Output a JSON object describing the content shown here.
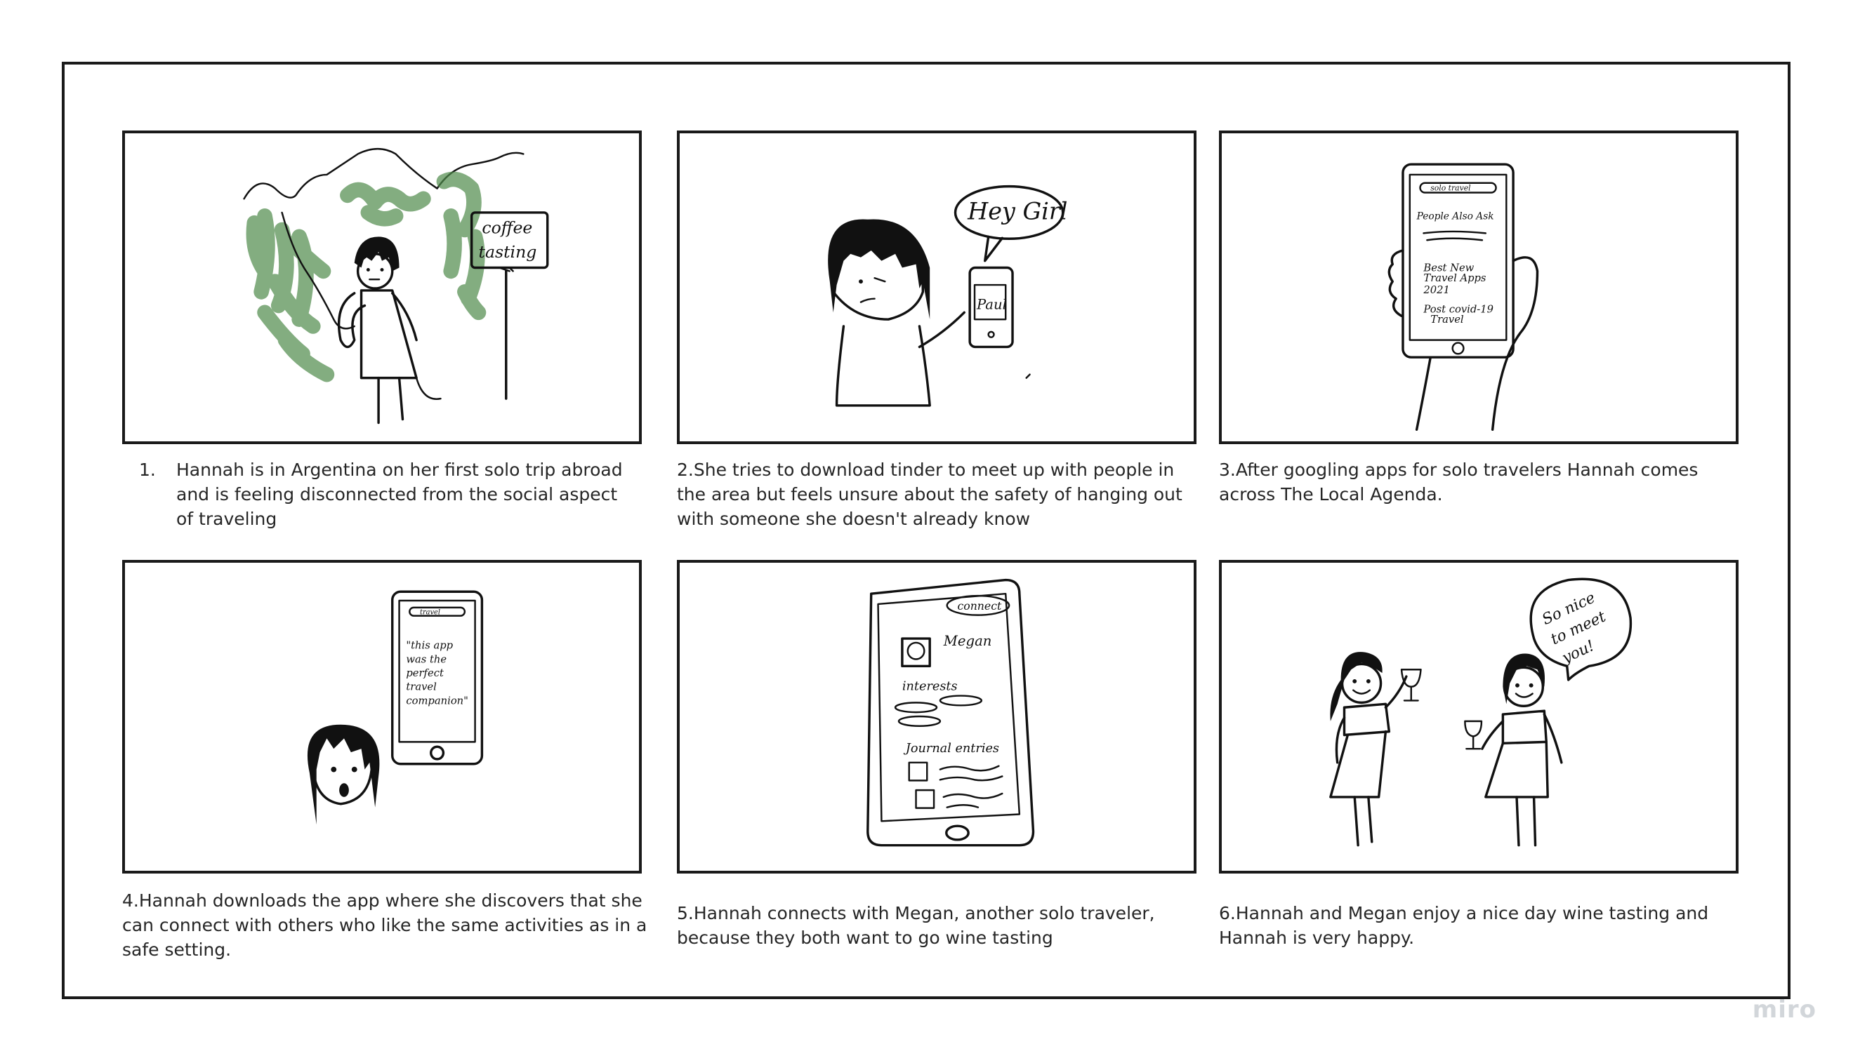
{
  "panels": [
    {
      "id": 1,
      "number": "1.",
      "caption": "Hannah is in Argentina on her first solo trip abroad and is feeling disconnected from the social aspect of traveling",
      "sketch_text": [
        "coffee",
        "tasting"
      ]
    },
    {
      "id": 2,
      "caption": "2.She tries to download tinder to meet up with people in the area but feels unsure about the safety of hanging out with someone she doesn't already know",
      "sketch_text": [
        "Hey Girl",
        "Paul"
      ]
    },
    {
      "id": 3,
      "caption": "3.After googling apps for solo travelers Hannah comes across The Local Agenda.",
      "sketch_text": [
        "solo travel",
        "People Also Ask",
        "Best New",
        "Travel Apps",
        "2021",
        "Post covid-19",
        "Travel"
      ]
    },
    {
      "id": 4,
      "caption": "4.Hannah downloads the app where she discovers that she can connect with others who like the same activities as in a safe setting.",
      "sketch_text": [
        "travel",
        "\"this app",
        "was the",
        "perfect",
        "travel",
        "companion\""
      ]
    },
    {
      "id": 5,
      "caption": "5.Hannah connects with Megan, another solo traveler, because they both want to go wine tasting",
      "sketch_text": [
        "connect",
        "Megan",
        "interests",
        "Journal entries"
      ]
    },
    {
      "id": 6,
      "caption": "6.Hannah and Megan enjoy a nice day wine tasting and Hannah is very happy.",
      "sketch_text": [
        "So nice",
        "to meet",
        "you!"
      ]
    }
  ],
  "watermark": "miro",
  "colors": {
    "ink": "#111111",
    "foliage": "#4f8a4a",
    "watermark": "#d2d6da"
  }
}
